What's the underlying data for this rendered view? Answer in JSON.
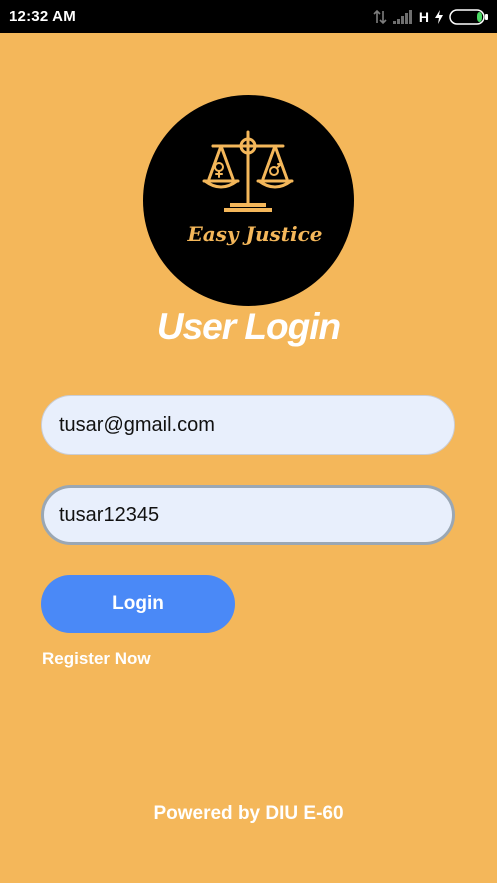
{
  "status_bar": {
    "time": "12:32 AM",
    "network_type": "H",
    "icons": [
      "data-transfer-icon",
      "signal-icon",
      "charging-icon",
      "battery-icon"
    ]
  },
  "logo": {
    "icon": "scales-of-justice-icon",
    "text": "Easy Justice"
  },
  "title": "User Login",
  "form": {
    "email_value": "tusar@gmail.com",
    "password_value": "tusar12345"
  },
  "login_button": "Login",
  "register_link": "Register Now",
  "footer": "Powered by DIU E-60",
  "colors": {
    "background": "#F4B75A",
    "logo_accent": "#F4B75A",
    "button": "#4A89F7",
    "field_fill": "#E8EFFC",
    "battery_level": "#4CD964"
  }
}
